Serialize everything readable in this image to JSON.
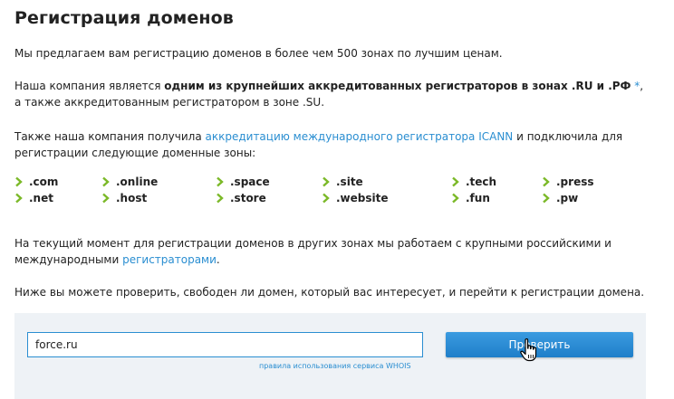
{
  "header": {
    "title": "Регистрация доменов"
  },
  "intro": {
    "p1": "Мы предлагаем вам регистрацию доменов в более чем 500 зонах по лучшим ценам.",
    "p2_start": "Наша компания является ",
    "p2_bold": "одним из крупнейших аккредитованных регистраторов в зонах .RU и .РФ",
    "p2_star": " *",
    "p2_end": ", а также аккредитованным регистратором в зоне .SU.",
    "p3_start": "Также наша компания получила ",
    "p3_link": "аккредитацию международного регистратора ICANN",
    "p3_end": " и подключила для регистрации следующие доменные зоны:"
  },
  "zones": [
    [
      ".com",
      ".net"
    ],
    [
      ".online",
      ".host"
    ],
    [
      ".space",
      ".store"
    ],
    [
      ".site",
      ".website"
    ],
    [
      ".tech",
      ".fun"
    ],
    [
      ".press",
      ".pw"
    ]
  ],
  "info": {
    "p4_start": "На текущий момент для регистрации доменов в других зонах мы работаем с крупными российскими и международными ",
    "p4_link": "регистраторами",
    "p4_end": ".",
    "p5": "Ниже вы можете проверить, свободен ли домен, который вас интересует, и перейти к регистрации домена."
  },
  "domain_check": {
    "input_value": "force.ru",
    "whois_link": "правила использования сервиса WHOIS",
    "button_label": "Проверить"
  },
  "colors": {
    "link": "#2a8ed1",
    "chevron": "#7bb928",
    "button": "#2a8ed1",
    "panel": "#eef2f6"
  },
  "icons": {
    "zone_bullet": "chevron-right-icon",
    "cursor": "hand-pointer-cursor"
  }
}
